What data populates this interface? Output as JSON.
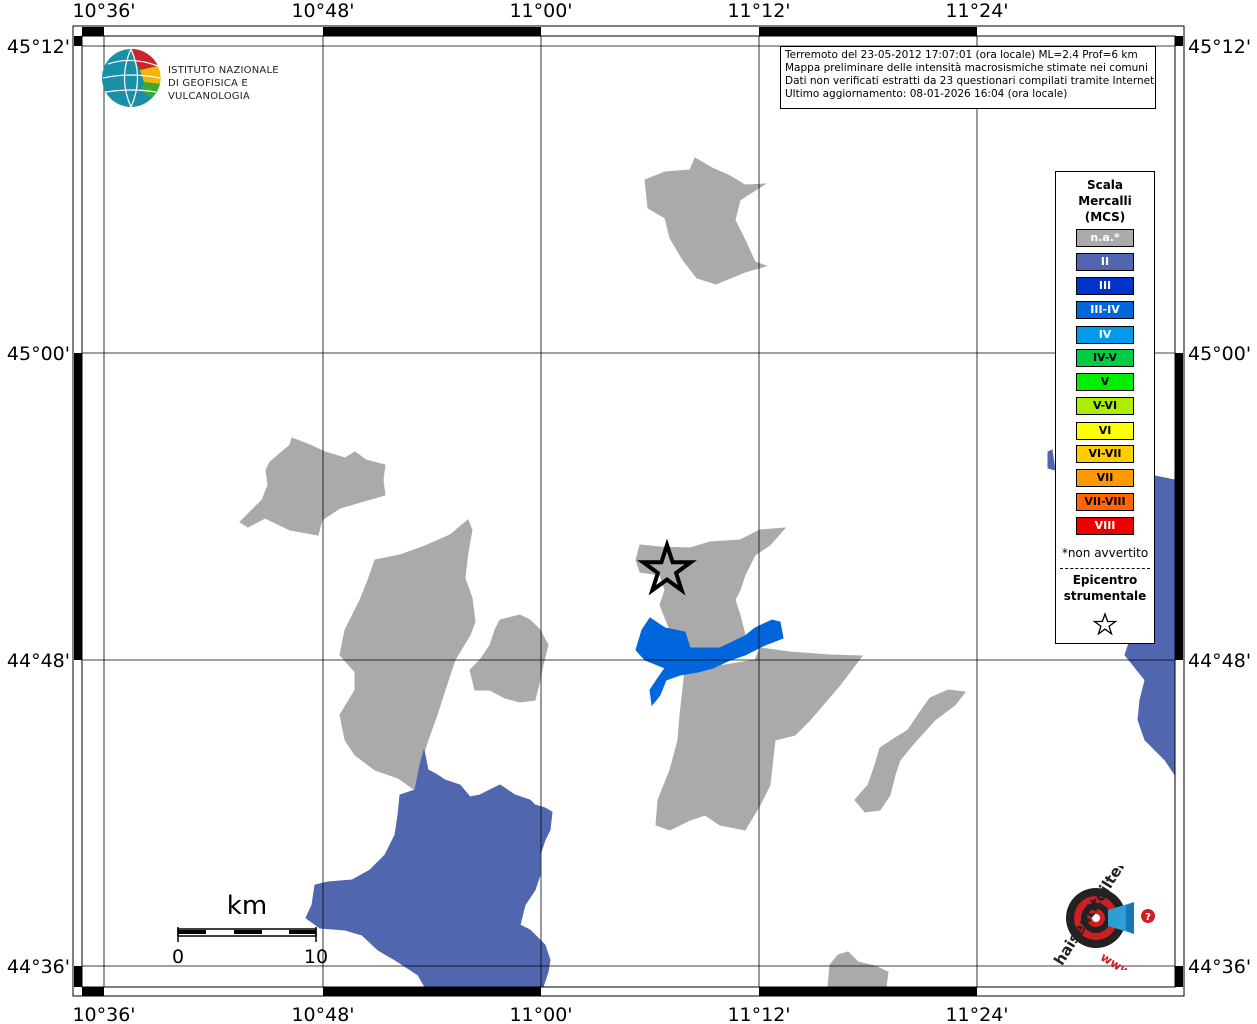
{
  "info": {
    "line1": "Terremoto del 23-05-2012 17:07:01 (ora locale) ML=2.4 Prof=6 km",
    "line2": "Mappa preliminare delle intensità macrosismiche stimate nei comuni",
    "line3": "Dati non verificati estratti da 23 questionari compilati tramite Internet.",
    "line4": "Ultimo aggiornamento: 08-01-2026 16:04 (ora locale)"
  },
  "axes": {
    "lon_labels": [
      "10°36'",
      "10°48'",
      "11°00'",
      "11°12'",
      "11°24'"
    ],
    "lat_labels": [
      "45°12'",
      "45°00'",
      "44°48'",
      "44°36'"
    ]
  },
  "scale_bar": {
    "unit": "km",
    "tick_start": "0",
    "tick_end": "10"
  },
  "logo": {
    "line1": "ISTITUTO NAZIONALE",
    "line2": "DI GEOFISICA E VULCANOLOGIA",
    "hst_text": "haisentitoilterremoto.it",
    "hst_url": "www."
  },
  "legend": {
    "title1": "Scala",
    "title2": "Mercalli",
    "title3": "(MCS)",
    "items": [
      {
        "label": "n.a.*",
        "color": "#aaaaaa",
        "text_color": "#ffffff"
      },
      {
        "label": "II",
        "color": "#5067b0",
        "text_color": "#ffffff"
      },
      {
        "label": "III",
        "color": "#0033cc",
        "text_color": "#ffffff"
      },
      {
        "label": "III-IV",
        "color": "#0066dd",
        "text_color": "#ffffff"
      },
      {
        "label": "IV",
        "color": "#0099ee",
        "text_color": "#ffffff"
      },
      {
        "label": "IV-V",
        "color": "#00cc44",
        "text_color": "#000000"
      },
      {
        "label": "V",
        "color": "#00ee00",
        "text_color": "#000000"
      },
      {
        "label": "V-VI",
        "color": "#aaee00",
        "text_color": "#000000"
      },
      {
        "label": "VI",
        "color": "#ffff00",
        "text_color": "#000000"
      },
      {
        "label": "VI-VII",
        "color": "#ffcc00",
        "text_color": "#000000"
      },
      {
        "label": "VII",
        "color": "#ff9900",
        "text_color": "#000000"
      },
      {
        "label": "VII-VIII",
        "color": "#ff6600",
        "text_color": "#000000"
      },
      {
        "label": "VIII",
        "color": "#ee0000",
        "text_color": "#ffffff"
      }
    ],
    "note": "*non avvertito",
    "epi1": "Epicentro",
    "epi2": "strumentale"
  },
  "colors": {
    "na": "#aaaaaa",
    "intensity_II": "#5067b0",
    "intensity_III_IV": "#0066dd"
  },
  "icons": {
    "epicenter": "star-icon"
  }
}
